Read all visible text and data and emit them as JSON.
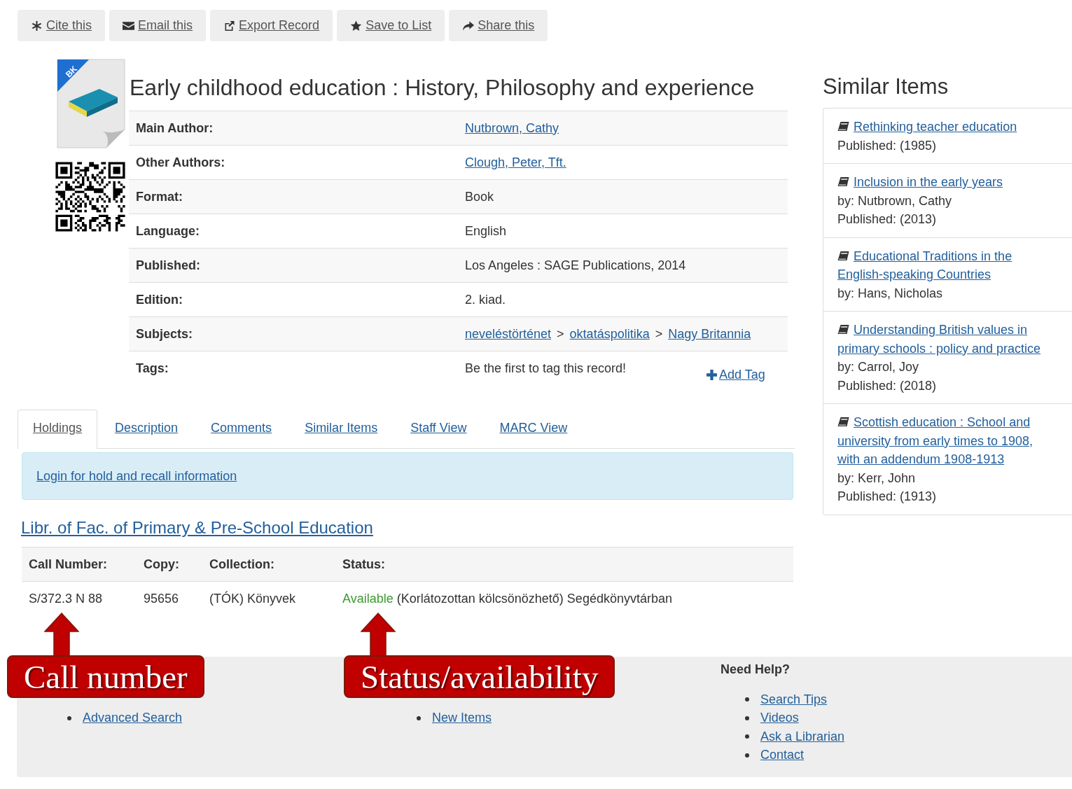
{
  "toolbar": [
    {
      "kind": "cite",
      "label": "Cite this"
    },
    {
      "kind": "email",
      "label": "Email this"
    },
    {
      "kind": "export",
      "label": "Export Record"
    },
    {
      "kind": "save",
      "label": "Save to List"
    },
    {
      "kind": "share",
      "label": "Share this"
    }
  ],
  "cover": {
    "badge": "BK"
  },
  "record": {
    "title": "Early childhood education : History, Philosophy and experience",
    "details": [
      {
        "kind": "links",
        "label": "Main Author:",
        "links": [
          "Nutbrown, Cathy"
        ]
      },
      {
        "kind": "links",
        "label": "Other Authors:",
        "links": [
          "Clough, Peter, Tft."
        ]
      },
      {
        "kind": "text",
        "label": "Format:",
        "value": "Book"
      },
      {
        "kind": "text",
        "label": "Language:",
        "value": "English"
      },
      {
        "kind": "text",
        "label": "Published:",
        "value": "Los Angeles : SAGE Publications, 2014"
      },
      {
        "kind": "text",
        "label": "Edition:",
        "value": "2. kiad."
      },
      {
        "kind": "subjects",
        "label": "Subjects:",
        "links": [
          "neveléstörténet",
          "oktatáspolitika",
          "Nagy Britannia"
        ],
        "separator": ">"
      },
      {
        "kind": "tags",
        "label": "Tags:",
        "value": "Be the first to tag this record!",
        "action": "Add Tag"
      }
    ]
  },
  "tabs": [
    {
      "label": "Holdings",
      "selected": true
    },
    {
      "label": "Description",
      "selected": false
    },
    {
      "label": "Comments",
      "selected": false
    },
    {
      "label": "Similar Items",
      "selected": false
    },
    {
      "label": "Staff View",
      "selected": false
    },
    {
      "label": "MARC View",
      "selected": false
    }
  ],
  "notice": {
    "link": "Login for hold and recall information"
  },
  "holdings": {
    "location": "Libr. of Fac. of Primary & Pre-School Education",
    "columns": [
      "Call Number:",
      "Copy:",
      "Collection:",
      "Status:"
    ],
    "rows": [
      {
        "call_number": "S/372.3 N 88",
        "copy": "95656",
        "collection": "(TÓK) Könyvek",
        "availability": "Available",
        "available": true,
        "note": "(Korlátozottan kölcsönözhető) Segédkönyvtárban"
      }
    ]
  },
  "similar_items": {
    "title": "Similar Items",
    "items": [
      {
        "title": "Rethinking teacher education",
        "lines": [
          "Published: (1985)"
        ]
      },
      {
        "title": "Inclusion in the early years",
        "lines": [
          "by: Nutbrown, Cathy",
          "Published: (2013)"
        ]
      },
      {
        "title": "Educational Traditions in the English-speaking Countries",
        "lines": [
          "by: Hans, Nicholas"
        ]
      },
      {
        "title": "Understanding British values in primary schools : policy and practice",
        "lines": [
          "by: Carrol, Joy",
          "Published: (2018)"
        ]
      },
      {
        "title": "Scottish education : School and university from early times to 1908, with an addendum 1908-1913",
        "lines": [
          "by: Kerr, John",
          "Published: (1913)"
        ]
      }
    ]
  },
  "footer": {
    "columns": [
      {
        "links": [
          "Advanced Search"
        ]
      },
      {
        "links": [
          "New Items"
        ]
      },
      {
        "heading": "Need Help?",
        "links": [
          "Search Tips",
          "Videos",
          "Ask a Librarian",
          "Contact"
        ]
      }
    ]
  },
  "annotations": [
    {
      "text": "Call number"
    },
    {
      "text": "Status/availability"
    }
  ]
}
